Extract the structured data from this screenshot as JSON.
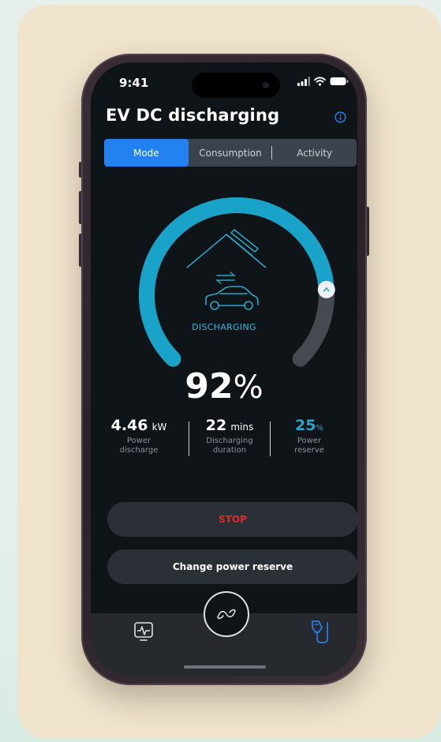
{
  "status_bar": {
    "time": "9:41"
  },
  "header": {
    "title": "EV DC discharging"
  },
  "tabs": [
    {
      "label": "Mode",
      "active": true
    },
    {
      "label": "Consumption",
      "active": false
    },
    {
      "label": "Activity",
      "active": false
    }
  ],
  "gauge": {
    "status": "DISCHARGING",
    "percent_value": "92",
    "percent_sign": "%",
    "fill_fraction": 0.82
  },
  "stats": [
    {
      "value": "4.46",
      "unit": "kW",
      "label_line1": "Power",
      "label_line2": "discharge",
      "color": "#ffffff"
    },
    {
      "value": "22",
      "unit": "mins",
      "label_line1": "Discharging",
      "label_line2": "duration",
      "color": "#ffffff"
    },
    {
      "value": "25",
      "unit": "%",
      "label_line1": "Power",
      "label_line2": "reserve",
      "color": "#2aa6c6"
    }
  ],
  "actions": {
    "stop_label": "STOP",
    "reserve_label": "Change power reserve"
  },
  "nav": {
    "left_icon": "pulse-monitor-icon",
    "center_icon": "infinity-icon",
    "right_icon": "ev-charger-plug-icon"
  },
  "colors": {
    "accent": "#2382ef",
    "gauge": "#1aa3c8",
    "stop": "#e12a2a"
  }
}
